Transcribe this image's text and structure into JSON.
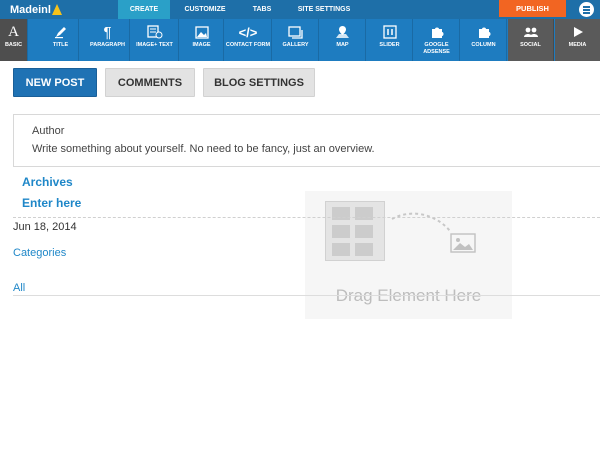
{
  "brand": {
    "logo_text": "Madeinl"
  },
  "topnav": {
    "tabs": [
      {
        "label": "CREATE",
        "active": true
      },
      {
        "label": "CUSTOMIZE",
        "active": false
      },
      {
        "label": "TABS",
        "active": false
      },
      {
        "label": "SITE SETTINGS",
        "active": false
      }
    ],
    "publish_label": "PUBLISH"
  },
  "toolbar": {
    "items": [
      {
        "label": "BASIC",
        "icon": "text-icon"
      },
      {
        "label": "TITLE",
        "icon": "pen-icon"
      },
      {
        "label": "PARAGRAPH",
        "icon": "paragraph-icon"
      },
      {
        "label": "IMAGE+ TEXT",
        "icon": "image-text-icon"
      },
      {
        "label": "IMAGE",
        "icon": "image-icon"
      },
      {
        "label": "CONTACT FORM",
        "icon": "code-icon"
      },
      {
        "label": "GALLERY",
        "icon": "gallery-icon"
      },
      {
        "label": "MAP",
        "icon": "map-icon"
      },
      {
        "label": "SLIDER",
        "icon": "slider-icon"
      },
      {
        "label": "GOOGLE ADSENSE",
        "icon": "puzzle-icon"
      },
      {
        "label": "COLUMN",
        "icon": "column-icon"
      },
      {
        "label": "SOCIAL",
        "icon": "social-icon"
      },
      {
        "label": "MEDIA",
        "icon": "play-icon"
      }
    ],
    "basic_glyph": "A"
  },
  "blog_tabs": {
    "new_post": "NEW POST",
    "comments": "COMMENTS",
    "blog_settings": "BLOG SETTINGS"
  },
  "author": {
    "title": "Author",
    "description": "Write something about yourself. No need to be fancy, just an overview."
  },
  "sidebar": {
    "archives_label": "Archives",
    "enter_here": "Enter here",
    "date": "Jun 18, 2014",
    "categories_label": "Categories",
    "all_label": "All"
  },
  "dropzone": {
    "text": "Drag Element Here"
  },
  "colors": {
    "topbar": "#1e6fa8",
    "toolbar": "#1e7cc0",
    "accent": "#2aa0c8",
    "publish": "#f26522",
    "link": "#1f87c8"
  }
}
